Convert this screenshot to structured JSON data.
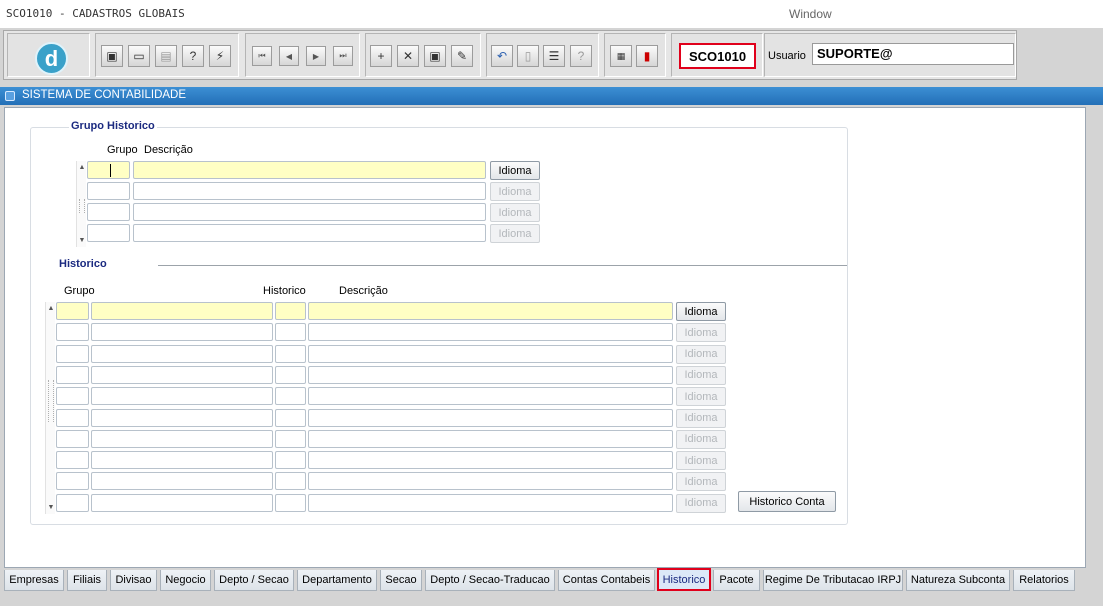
{
  "app": {
    "title": "SCO1010 - CADASTROS GLOBAIS",
    "window_menu": "Window"
  },
  "toolbar": {
    "logo_letter": "d",
    "groups": [
      [
        "save-icon",
        "print-preview-icon",
        "print-icon",
        "query-help-icon",
        "execute-query-icon"
      ],
      [
        "first-record-icon",
        "previous-record-icon",
        "next-record-icon",
        "last-record-icon"
      ],
      [
        "insert-record-icon",
        "delete-record-icon",
        "duplicate-record-icon",
        "clear-record-icon"
      ],
      [
        "undo-icon",
        "paste-icon",
        "list-values-icon",
        "help-icon"
      ],
      [
        "menu-icon",
        "exit-icon"
      ]
    ],
    "form_code": "SCO1010",
    "user_label": "Usuario",
    "user_value": "SUPORTE@"
  },
  "window": {
    "title": "SISTEMA DE CONTABILIDADE"
  },
  "grupo_historico": {
    "title": "Grupo Historico",
    "headers": {
      "grupo": "Grupo",
      "descricao": "Descrição"
    },
    "row_button": "Idioma",
    "rows": 4
  },
  "historico": {
    "title": "Historico",
    "headers": {
      "grupo": "Grupo",
      "historico": "Historico",
      "descricao": "Descrição"
    },
    "row_button": "Idioma",
    "rows": 10,
    "historico_conta_button": "Historico Conta"
  },
  "tabs": [
    {
      "label": "Empresas",
      "active": false
    },
    {
      "label": "Filiais",
      "active": false
    },
    {
      "label": "Divisao",
      "active": false
    },
    {
      "label": "Negocio",
      "active": false
    },
    {
      "label": "Depto / Secao",
      "active": false
    },
    {
      "label": "Departamento",
      "active": false
    },
    {
      "label": "Secao",
      "active": false
    },
    {
      "label": "Depto / Secao-Traducao",
      "active": false
    },
    {
      "label": "Contas Contabeis",
      "active": false
    },
    {
      "label": "Historico",
      "active": true
    },
    {
      "label": "Pacote",
      "active": false
    },
    {
      "label": "Regime De Tributacao IRPJ",
      "active": false
    },
    {
      "label": "Natureza Subconta",
      "active": false
    },
    {
      "label": "Relatorios",
      "active": false
    }
  ],
  "colors": {
    "title_bar": "#236fb7",
    "current_field": "#ffffc4",
    "highlight_border": "#e0001b",
    "frame_title": "#1b2a80"
  }
}
